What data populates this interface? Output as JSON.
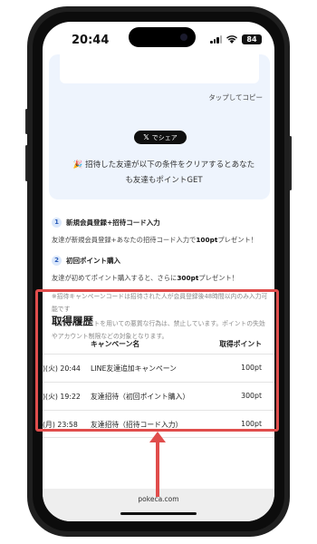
{
  "status_bar": {
    "time": "20:44",
    "battery": "84"
  },
  "share": {
    "tap_copy": "タップしてコピー",
    "x_button_label": "でシェア",
    "x_logo": "𝕏",
    "message_line1": "🎉 招待した友達が以下の条件をクリアするとあなた",
    "message_line2": "も友達もポイントGET"
  },
  "conditions": [
    {
      "num": "1",
      "title": "新規会員登録+招待コード入力",
      "desc_prefix": "友達が新規会員登録+あなたの招待コード入力で",
      "desc_points": "100pt",
      "desc_suffix": "プレゼント！"
    },
    {
      "num": "2",
      "title": "初回ポイント購入",
      "desc_prefix": "友達が初めてポイント購入すると、さらに",
      "desc_points": "300pt",
      "desc_suffix": "プレゼント！"
    }
  ],
  "notes": [
    "※招待キャンペーンコードは招待された人が会員登録後48時間以内のみ入力可能です",
    "※複数アカウントを用いての悪質な行為は、禁止しています。ポイントの失効やアカウント制限などの対象となります。"
  ],
  "history": {
    "title": "取得履歴",
    "columns": {
      "campaign": "キャンペーン名",
      "points": "取得ポイント"
    },
    "rows": [
      {
        "date": ")(火) 20:44",
        "campaign": "LINE友達追加キャンペーン",
        "points": "100pt"
      },
      {
        "date": ")(火) 19:22",
        "campaign": "友達招待（初回ポイント購入）",
        "points": "300pt"
      },
      {
        "date": "(月) 23:58",
        "campaign": "友達招待（招待コード入力）",
        "points": "100pt"
      }
    ]
  },
  "url_bar": {
    "domain": "pokeca.com"
  },
  "colors": {
    "highlight": "#e04d4c",
    "card_bg": "#eef4fd",
    "badge_bg": "#dbe8fb"
  }
}
